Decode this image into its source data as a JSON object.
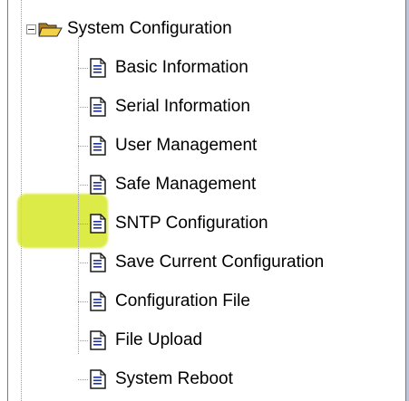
{
  "tree": {
    "root": {
      "label": "System Configuration",
      "icon": "folder-open-icon",
      "expanded": true
    },
    "items": [
      {
        "label": "Basic Information",
        "icon": "document-icon"
      },
      {
        "label": "Serial Information",
        "icon": "document-icon"
      },
      {
        "label": "User Management",
        "icon": "document-icon"
      },
      {
        "label": "Safe Management",
        "icon": "document-icon"
      },
      {
        "label": "SNTP Configuration",
        "icon": "document-icon"
      },
      {
        "label": "Save Current Configuration",
        "icon": "document-icon"
      },
      {
        "label": "Configuration File",
        "icon": "document-icon"
      },
      {
        "label": "File Upload",
        "icon": "document-icon"
      },
      {
        "label": "System Reboot",
        "icon": "document-icon"
      }
    ]
  },
  "colors": {
    "highlight": "#d6e828",
    "folder": "#f2d24a",
    "document_ink": "#1d2f9a"
  }
}
